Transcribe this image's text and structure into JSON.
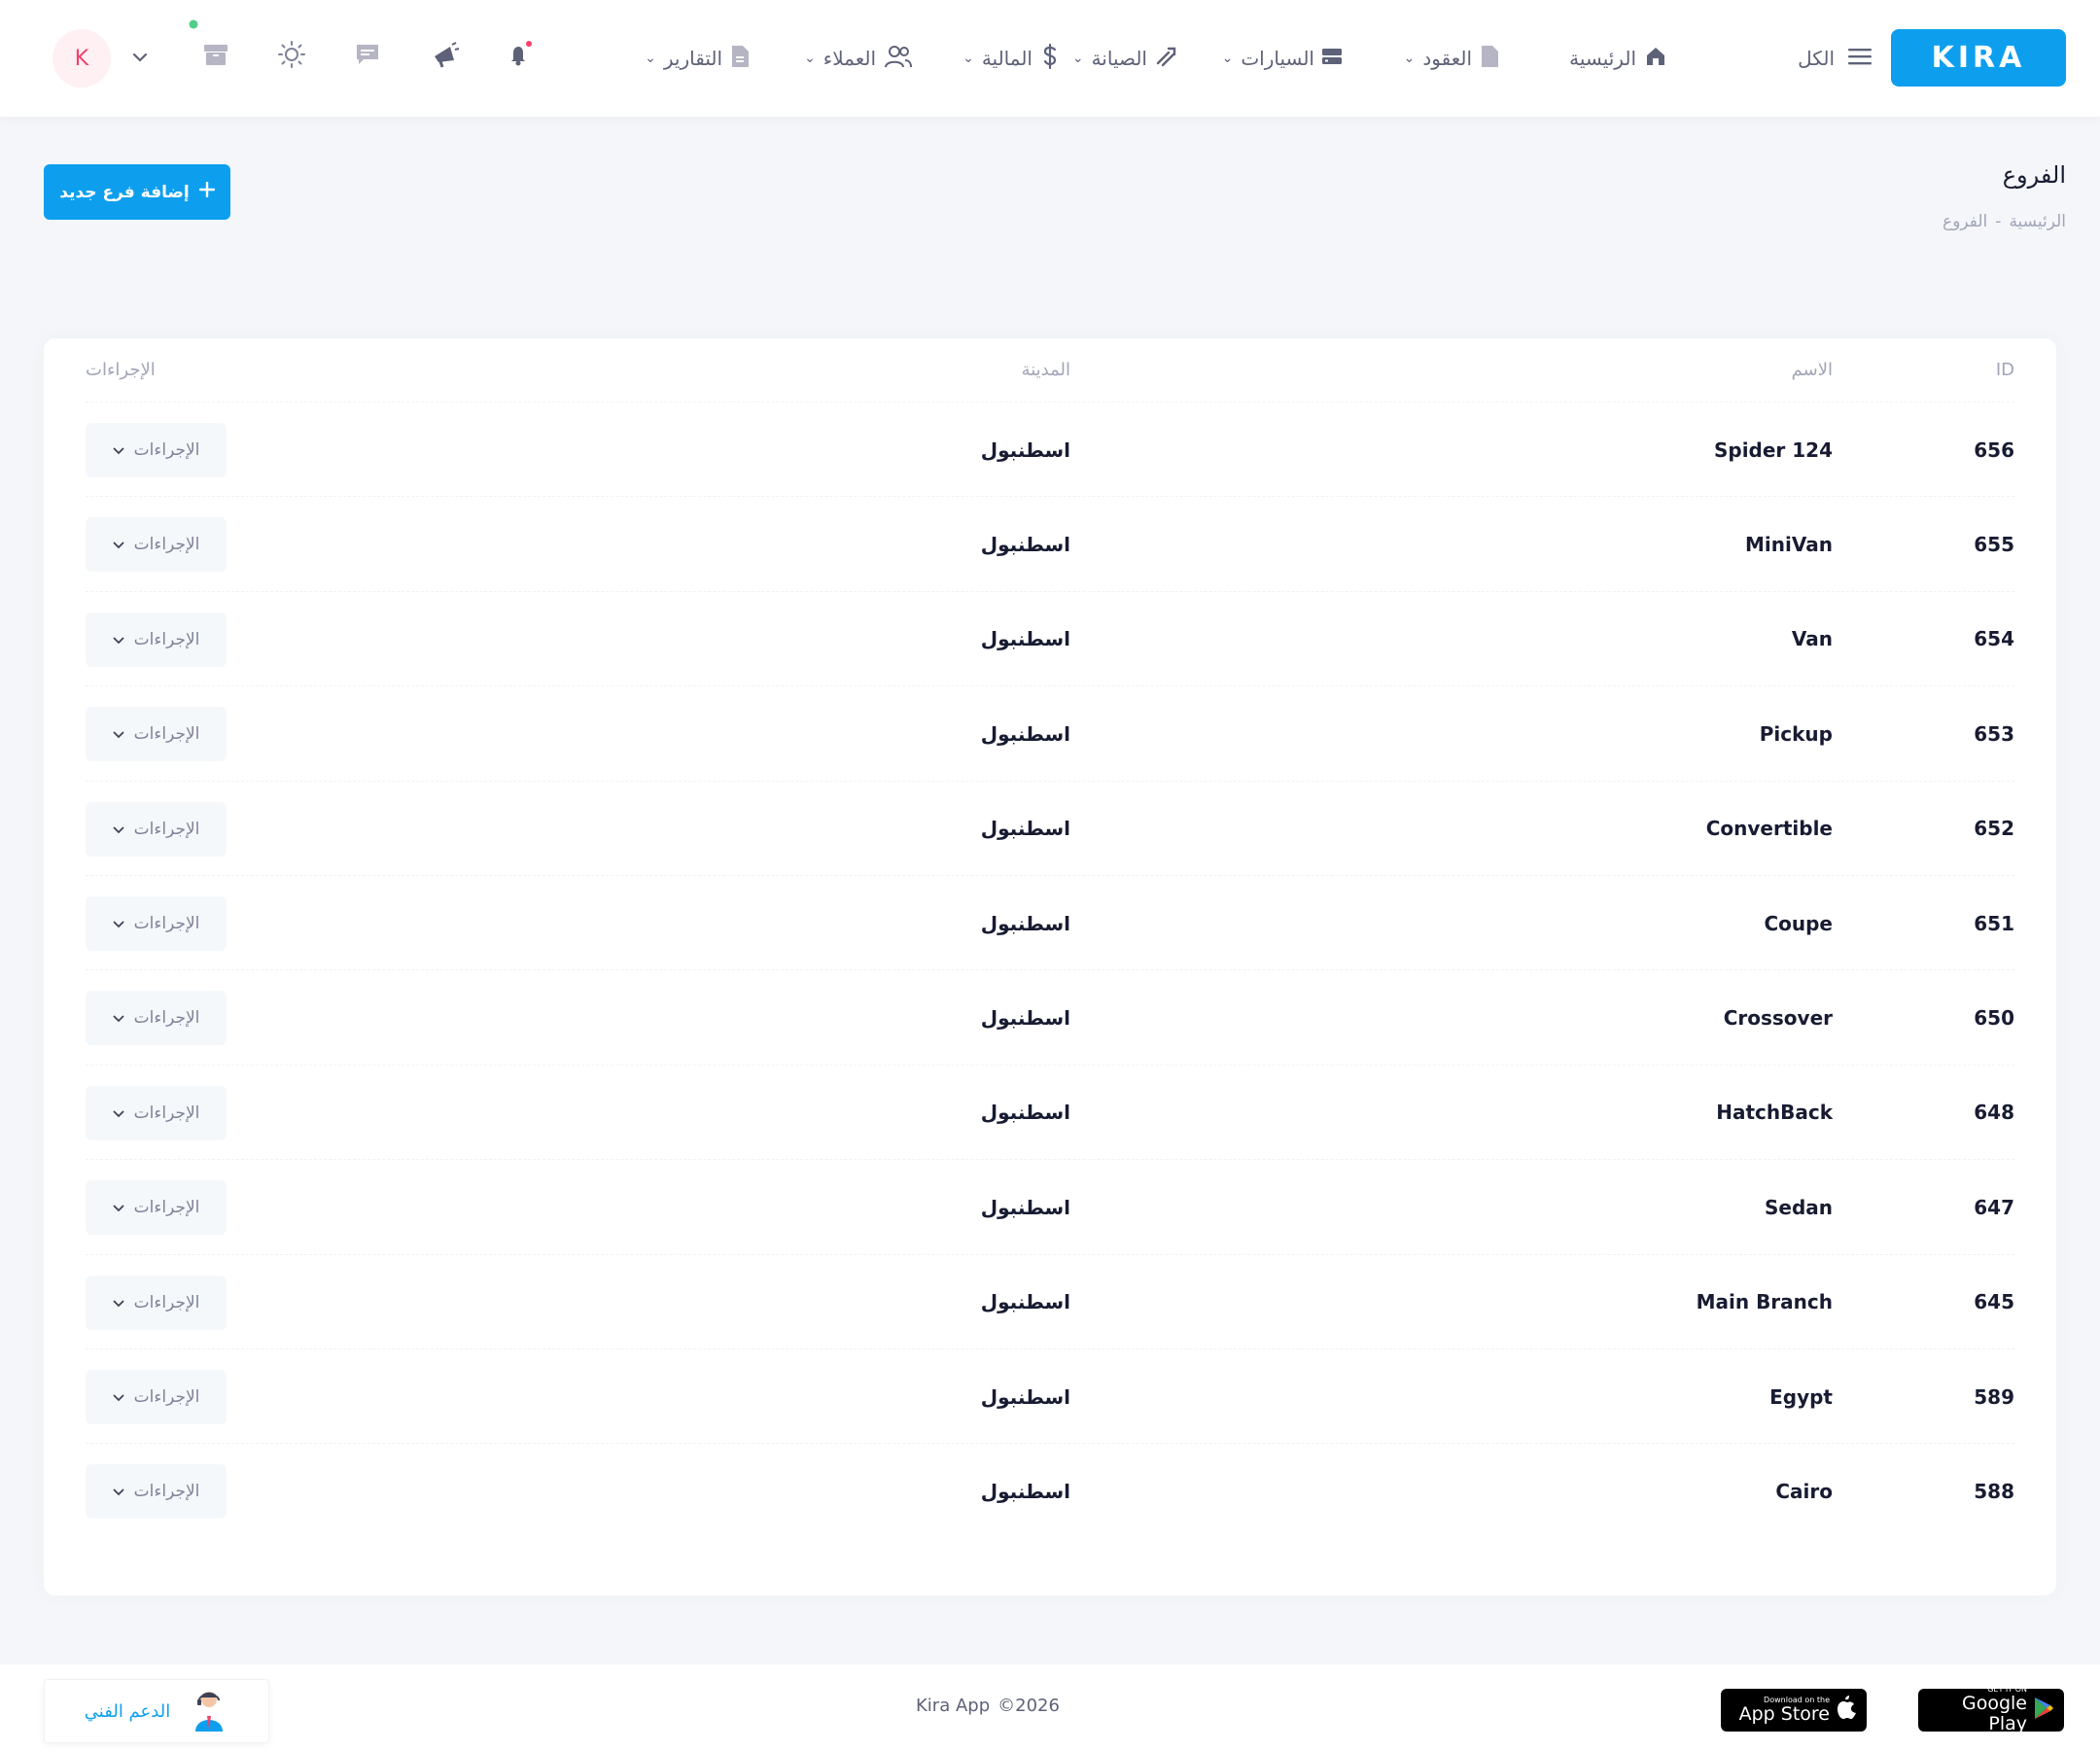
{
  "brand": {
    "logo_text": "KIRA",
    "color": "#0d9fee"
  },
  "header": {
    "all_label": "الكل",
    "nav": [
      {
        "label": "الرئيسية",
        "icon": "home-icon"
      },
      {
        "label": "العقود",
        "icon": "document-icon"
      },
      {
        "label": "السيارات",
        "icon": "server-icon"
      },
      {
        "label": "الصيانة",
        "icon": "wrench-icon"
      },
      {
        "label": "المالية",
        "icon": "dollar-icon"
      },
      {
        "label": "العملاء",
        "icon": "users-icon"
      },
      {
        "label": "التقارير",
        "icon": "report-icon"
      }
    ],
    "avatar_letter": "K"
  },
  "toolbar": {
    "title": "الفروع",
    "breadcrumb": [
      "الرئيسية",
      "-",
      "الفروع"
    ],
    "add_button": "إضافة فرع جديد"
  },
  "table": {
    "headers": {
      "id": "ID",
      "name": "الاسم",
      "city": "المدينة",
      "actions": "الإجراءات"
    },
    "action_label": "الإجراءات",
    "rows": [
      {
        "id": "656",
        "name": "Spider 124",
        "city": "اسطنبول"
      },
      {
        "id": "655",
        "name": "MiniVan",
        "city": "اسطنبول"
      },
      {
        "id": "654",
        "name": "Van",
        "city": "اسطنبول"
      },
      {
        "id": "653",
        "name": "Pickup",
        "city": "اسطنبول"
      },
      {
        "id": "652",
        "name": "Convertible",
        "city": "اسطنبول"
      },
      {
        "id": "651",
        "name": "Coupe",
        "city": "اسطنبول"
      },
      {
        "id": "650",
        "name": "Crossover",
        "city": "اسطنبول"
      },
      {
        "id": "648",
        "name": "HatchBack",
        "city": "اسطنبول"
      },
      {
        "id": "647",
        "name": "Sedan",
        "city": "اسطنبول"
      },
      {
        "id": "645",
        "name": "Main Branch",
        "city": "اسطنبول"
      },
      {
        "id": "589",
        "name": "Egypt",
        "city": "اسطنبول"
      },
      {
        "id": "588",
        "name": "Cairo",
        "city": "اسطنبول"
      }
    ]
  },
  "footer": {
    "google_play_small": "GET IT ON",
    "google_play_big": "Google Play",
    "app_store_small": "Download on the",
    "app_store_big": "App Store",
    "copyright_year": "©2026",
    "copyright_name": "Kira App",
    "support_label": "الدعم الفني"
  }
}
